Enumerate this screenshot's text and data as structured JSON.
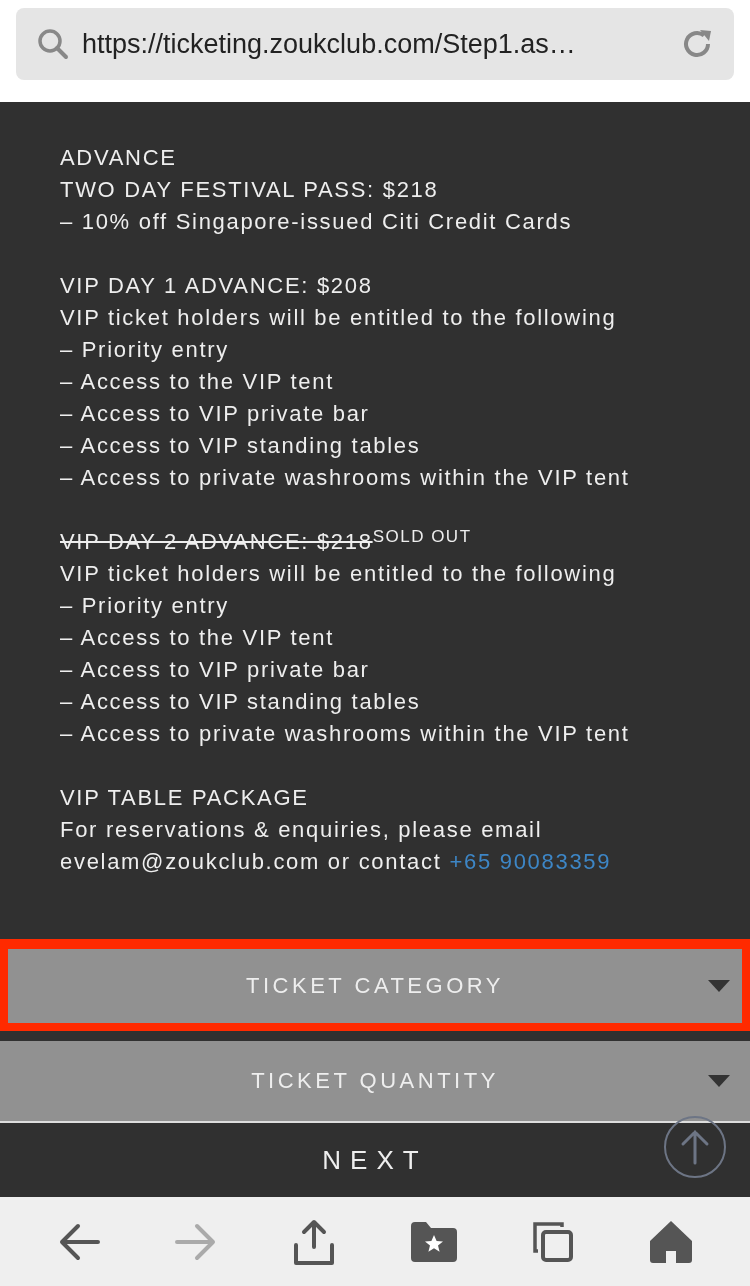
{
  "address_bar": {
    "url": "https://ticketing.zoukclub.com/Step1.as…"
  },
  "sections": [
    {
      "title": "ADVANCE",
      "sold_out": false,
      "lines": [
        "TWO DAY FESTIVAL PASS: $218",
        "– 10% off Singapore-issued Citi Credit Cards"
      ]
    },
    {
      "title": "VIP DAY 1 ADVANCE: $208",
      "sold_out": false,
      "lines": [
        "VIP ticket holders will be entitled to the following",
        "– Priority entry",
        "– Access to the VIP tent",
        "– Access to VIP private bar",
        "– Access to VIP standing tables",
        "– Access to private washrooms within the VIP tent"
      ]
    },
    {
      "title": "VIP DAY 2 ADVANCE: $218",
      "sold_out": true,
      "badge": "SOLD OUT",
      "lines": [
        "VIP ticket holders will be entitled to the following",
        "– Priority entry",
        "– Access to the VIP tent",
        "– Access to VIP private bar",
        "– Access to VIP standing tables",
        "– Access to private washrooms within the VIP tent"
      ]
    },
    {
      "title": "VIP TABLE PACKAGE",
      "sold_out": false,
      "lines": [
        "For reservations & enquiries, please email"
      ],
      "contact": {
        "text": "evelam@zoukclub.com or contact",
        "link": "+65 90083359"
      }
    }
  ],
  "dropdowns": [
    {
      "label": "TICKET CATEGORY",
      "highlighted": true
    },
    {
      "label": "TICKET QUANTITY",
      "highlighted": false
    }
  ],
  "next_button": "NEXT",
  "toolbar": {
    "back_disabled": false,
    "forward_disabled": true
  }
}
